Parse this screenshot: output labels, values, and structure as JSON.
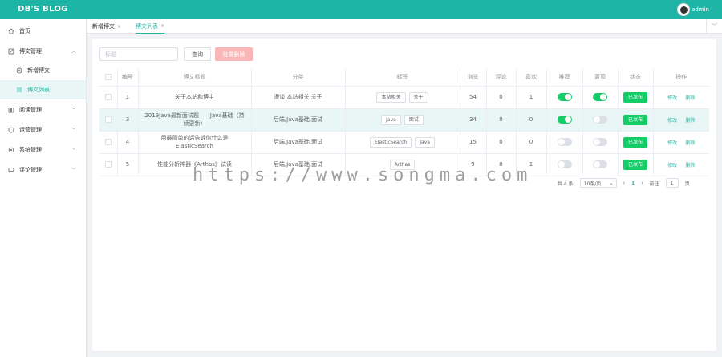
{
  "app": {
    "brand": "DB'S BLOG",
    "user": "admin"
  },
  "sidebar": {
    "items": [
      {
        "label": "首页",
        "icon": "home-icon"
      },
      {
        "label": "博文管理",
        "icon": "edit-icon",
        "expanded": true,
        "children": [
          {
            "label": "新增博文",
            "icon": "plus-circle-icon"
          },
          {
            "label": "博文列表",
            "icon": "list-icon",
            "active": true
          }
        ]
      },
      {
        "label": "阅读管理",
        "icon": "book-icon"
      },
      {
        "label": "运营管理",
        "icon": "shield-icon"
      },
      {
        "label": "系统管理",
        "icon": "gear-icon"
      },
      {
        "label": "评论管理",
        "icon": "comment-icon"
      }
    ]
  },
  "tabs": [
    {
      "label": "新增博文",
      "close": "×"
    },
    {
      "label": "博文列表",
      "close": "×",
      "active": true
    }
  ],
  "toolbar": {
    "search_placeholder": "标题",
    "query_label": "查询",
    "batch_delete_label": "批量删除"
  },
  "table": {
    "headers": [
      "编号",
      "博文标题",
      "分类",
      "标签",
      "浏览",
      "评论",
      "喜欢",
      "推荐",
      "置顶",
      "状态",
      "操作"
    ],
    "rows": [
      {
        "id": "1",
        "title": "关于本站和博主",
        "category": "漫谈,本站相关,关于",
        "tags": [
          "本站相关",
          "关于"
        ],
        "views": "54",
        "comments": "0",
        "likes": "1",
        "recommend": true,
        "top": true,
        "status": "已发布"
      },
      {
        "id": "3",
        "title": "2019Java最新面试题——Java基础（持续更新）",
        "category": "后端,Java基础,面试",
        "tags": [
          "Java",
          "面试"
        ],
        "views": "34",
        "comments": "0",
        "likes": "0",
        "recommend": true,
        "top": false,
        "status": "已发布",
        "highlight": true
      },
      {
        "id": "4",
        "title": "用最简单的话告诉你什么是ElasticSearch",
        "category": "后端,Java基础,面试",
        "tags": [
          "ElasticSearch",
          "Java"
        ],
        "views": "15",
        "comments": "0",
        "likes": "0",
        "recommend": false,
        "top": false,
        "status": "已发布"
      },
      {
        "id": "5",
        "title": "性能分析神器《Arthas》试读",
        "category": "后端,Java基础,面试",
        "tags": [
          "Arthas"
        ],
        "views": "9",
        "comments": "0",
        "likes": "1",
        "recommend": false,
        "top": false,
        "status": "已发布"
      }
    ],
    "actions": {
      "edit": "修改",
      "delete": "删除"
    }
  },
  "pagination": {
    "total": "共 4 条",
    "page_size": "10条/页",
    "prev": "‹",
    "current": "1",
    "next": "›",
    "goto": "前往",
    "goto_value": "1",
    "page_unit": "页"
  },
  "watermark": "https://www.songma.com",
  "colors": {
    "brand": "#1fb5a6",
    "success": "#13ce66",
    "danger_light": "#fab6b6"
  }
}
